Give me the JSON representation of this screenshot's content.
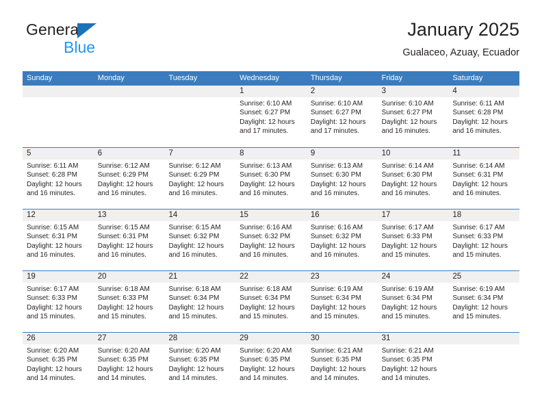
{
  "brand": {
    "name_top": "General",
    "name_bottom": "Blue",
    "triangle_color": "#1b72b8",
    "blue_color": "#2196f3"
  },
  "header": {
    "title": "January 2025",
    "location": "Gualaceo, Azuay, Ecuador"
  },
  "theme": {
    "header_bar": "#3a7cbe",
    "day_band": "#f0f0f0",
    "text": "#231f20"
  },
  "weekdays": [
    "Sunday",
    "Monday",
    "Tuesday",
    "Wednesday",
    "Thursday",
    "Friday",
    "Saturday"
  ],
  "weeks": [
    [
      {
        "empty": true
      },
      {
        "empty": true
      },
      {
        "empty": true
      },
      {
        "day": "1",
        "sunrise": "Sunrise: 6:10 AM",
        "sunset": "Sunset: 6:27 PM",
        "daylight1": "Daylight: 12 hours",
        "daylight2": "and 17 minutes."
      },
      {
        "day": "2",
        "sunrise": "Sunrise: 6:10 AM",
        "sunset": "Sunset: 6:27 PM",
        "daylight1": "Daylight: 12 hours",
        "daylight2": "and 17 minutes."
      },
      {
        "day": "3",
        "sunrise": "Sunrise: 6:10 AM",
        "sunset": "Sunset: 6:27 PM",
        "daylight1": "Daylight: 12 hours",
        "daylight2": "and 16 minutes."
      },
      {
        "day": "4",
        "sunrise": "Sunrise: 6:11 AM",
        "sunset": "Sunset: 6:28 PM",
        "daylight1": "Daylight: 12 hours",
        "daylight2": "and 16 minutes."
      }
    ],
    [
      {
        "day": "5",
        "sunrise": "Sunrise: 6:11 AM",
        "sunset": "Sunset: 6:28 PM",
        "daylight1": "Daylight: 12 hours",
        "daylight2": "and 16 minutes."
      },
      {
        "day": "6",
        "sunrise": "Sunrise: 6:12 AM",
        "sunset": "Sunset: 6:29 PM",
        "daylight1": "Daylight: 12 hours",
        "daylight2": "and 16 minutes."
      },
      {
        "day": "7",
        "sunrise": "Sunrise: 6:12 AM",
        "sunset": "Sunset: 6:29 PM",
        "daylight1": "Daylight: 12 hours",
        "daylight2": "and 16 minutes."
      },
      {
        "day": "8",
        "sunrise": "Sunrise: 6:13 AM",
        "sunset": "Sunset: 6:30 PM",
        "daylight1": "Daylight: 12 hours",
        "daylight2": "and 16 minutes."
      },
      {
        "day": "9",
        "sunrise": "Sunrise: 6:13 AM",
        "sunset": "Sunset: 6:30 PM",
        "daylight1": "Daylight: 12 hours",
        "daylight2": "and 16 minutes."
      },
      {
        "day": "10",
        "sunrise": "Sunrise: 6:14 AM",
        "sunset": "Sunset: 6:30 PM",
        "daylight1": "Daylight: 12 hours",
        "daylight2": "and 16 minutes."
      },
      {
        "day": "11",
        "sunrise": "Sunrise: 6:14 AM",
        "sunset": "Sunset: 6:31 PM",
        "daylight1": "Daylight: 12 hours",
        "daylight2": "and 16 minutes."
      }
    ],
    [
      {
        "day": "12",
        "sunrise": "Sunrise: 6:15 AM",
        "sunset": "Sunset: 6:31 PM",
        "daylight1": "Daylight: 12 hours",
        "daylight2": "and 16 minutes."
      },
      {
        "day": "13",
        "sunrise": "Sunrise: 6:15 AM",
        "sunset": "Sunset: 6:31 PM",
        "daylight1": "Daylight: 12 hours",
        "daylight2": "and 16 minutes."
      },
      {
        "day": "14",
        "sunrise": "Sunrise: 6:15 AM",
        "sunset": "Sunset: 6:32 PM",
        "daylight1": "Daylight: 12 hours",
        "daylight2": "and 16 minutes."
      },
      {
        "day": "15",
        "sunrise": "Sunrise: 6:16 AM",
        "sunset": "Sunset: 6:32 PM",
        "daylight1": "Daylight: 12 hours",
        "daylight2": "and 16 minutes."
      },
      {
        "day": "16",
        "sunrise": "Sunrise: 6:16 AM",
        "sunset": "Sunset: 6:32 PM",
        "daylight1": "Daylight: 12 hours",
        "daylight2": "and 16 minutes."
      },
      {
        "day": "17",
        "sunrise": "Sunrise: 6:17 AM",
        "sunset": "Sunset: 6:33 PM",
        "daylight1": "Daylight: 12 hours",
        "daylight2": "and 15 minutes."
      },
      {
        "day": "18",
        "sunrise": "Sunrise: 6:17 AM",
        "sunset": "Sunset: 6:33 PM",
        "daylight1": "Daylight: 12 hours",
        "daylight2": "and 15 minutes."
      }
    ],
    [
      {
        "day": "19",
        "sunrise": "Sunrise: 6:17 AM",
        "sunset": "Sunset: 6:33 PM",
        "daylight1": "Daylight: 12 hours",
        "daylight2": "and 15 minutes."
      },
      {
        "day": "20",
        "sunrise": "Sunrise: 6:18 AM",
        "sunset": "Sunset: 6:33 PM",
        "daylight1": "Daylight: 12 hours",
        "daylight2": "and 15 minutes."
      },
      {
        "day": "21",
        "sunrise": "Sunrise: 6:18 AM",
        "sunset": "Sunset: 6:34 PM",
        "daylight1": "Daylight: 12 hours",
        "daylight2": "and 15 minutes."
      },
      {
        "day": "22",
        "sunrise": "Sunrise: 6:18 AM",
        "sunset": "Sunset: 6:34 PM",
        "daylight1": "Daylight: 12 hours",
        "daylight2": "and 15 minutes."
      },
      {
        "day": "23",
        "sunrise": "Sunrise: 6:19 AM",
        "sunset": "Sunset: 6:34 PM",
        "daylight1": "Daylight: 12 hours",
        "daylight2": "and 15 minutes."
      },
      {
        "day": "24",
        "sunrise": "Sunrise: 6:19 AM",
        "sunset": "Sunset: 6:34 PM",
        "daylight1": "Daylight: 12 hours",
        "daylight2": "and 15 minutes."
      },
      {
        "day": "25",
        "sunrise": "Sunrise: 6:19 AM",
        "sunset": "Sunset: 6:34 PM",
        "daylight1": "Daylight: 12 hours",
        "daylight2": "and 15 minutes."
      }
    ],
    [
      {
        "day": "26",
        "sunrise": "Sunrise: 6:20 AM",
        "sunset": "Sunset: 6:35 PM",
        "daylight1": "Daylight: 12 hours",
        "daylight2": "and 14 minutes."
      },
      {
        "day": "27",
        "sunrise": "Sunrise: 6:20 AM",
        "sunset": "Sunset: 6:35 PM",
        "daylight1": "Daylight: 12 hours",
        "daylight2": "and 14 minutes."
      },
      {
        "day": "28",
        "sunrise": "Sunrise: 6:20 AM",
        "sunset": "Sunset: 6:35 PM",
        "daylight1": "Daylight: 12 hours",
        "daylight2": "and 14 minutes."
      },
      {
        "day": "29",
        "sunrise": "Sunrise: 6:20 AM",
        "sunset": "Sunset: 6:35 PM",
        "daylight1": "Daylight: 12 hours",
        "daylight2": "and 14 minutes."
      },
      {
        "day": "30",
        "sunrise": "Sunrise: 6:21 AM",
        "sunset": "Sunset: 6:35 PM",
        "daylight1": "Daylight: 12 hours",
        "daylight2": "and 14 minutes."
      },
      {
        "day": "31",
        "sunrise": "Sunrise: 6:21 AM",
        "sunset": "Sunset: 6:35 PM",
        "daylight1": "Daylight: 12 hours",
        "daylight2": "and 14 minutes."
      },
      {
        "empty": true
      }
    ]
  ]
}
